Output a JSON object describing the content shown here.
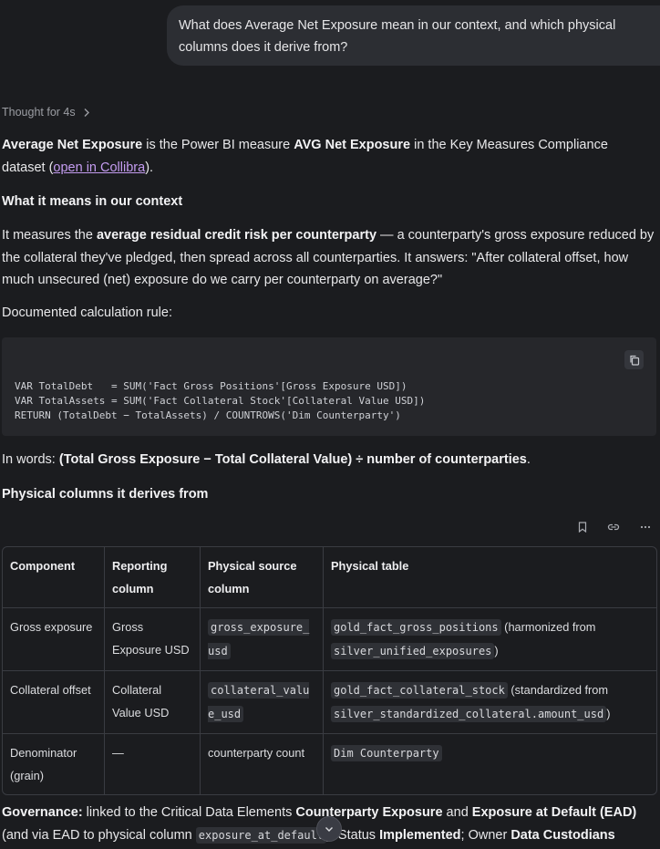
{
  "user_message": "What does Average Net Exposure mean in our context, and which physical columns does it derive from?",
  "thought": {
    "label": "Thought for 4s",
    "icon": "chevron-right-icon"
  },
  "intro": {
    "term": "Average Net Exposure",
    "text1": " is the Power BI measure ",
    "measure": "AVG Net Exposure",
    "text2": " in the Key Measures Compliance dataset (",
    "link": "open in Collibra",
    "text3": ")."
  },
  "section1_heading": "What it means in our context",
  "meaning": {
    "text1": "It measures the ",
    "bold": "average residual credit risk per counterparty",
    "text2": " — a counterparty's gross exposure reduced by the collateral they've pledged, then spread across all counterparties. It answers: \"After collateral offset, how much unsecured (net) exposure do we carry per counterparty on average?\""
  },
  "calc_label": "Documented calculation rule:",
  "code": {
    "content": "VAR TotalDebt   = SUM('Fact Gross Positions'[Gross Exposure USD])\nVAR TotalAssets = SUM('Fact Collateral Stock'[Collateral Value USD])\nRETURN (TotalDebt − TotalAssets) / COUNTROWS('Dim Counterparty')",
    "copy_icon": "copy-icon"
  },
  "in_words": {
    "prefix": "In words: ",
    "formula": "(Total Gross Exposure − Total Collateral Value) ÷ number of counterparties",
    "suffix": "."
  },
  "section2_heading": "Physical columns it derives from",
  "table_tools": [
    "bookmark-icon",
    "link-icon",
    "more-icon"
  ],
  "table": {
    "headers": [
      "Component",
      "Reporting column",
      "Physical source column",
      "Physical table"
    ],
    "rows": [
      {
        "component": "Gross exposure",
        "reporting": "Gross Exposure USD",
        "source": "gross_exposure_usd",
        "table_code": "gold_fact_gross_positions",
        "note": " (harmonized from ",
        "from_code": "silver_unified_exposures",
        "close": ")"
      },
      {
        "component": "Collateral offset",
        "reporting": "Collateral Value USD",
        "source": "collateral_value_usd",
        "table_code": "gold_fact_collateral_stock",
        "note": " (standardized from ",
        "from_code": "silver_standardized_collateral.amount_usd",
        "close": ")"
      },
      {
        "component": "Denominator (grain)",
        "reporting": "—",
        "source": "counterparty count",
        "table_code": "Dim Counterparty",
        "note": "",
        "from_code": "",
        "close": ""
      }
    ]
  },
  "governance": {
    "label": "Governance:",
    "text1": " linked to the Critical Data Elements ",
    "cde1": "Counterparty Exposure",
    "and": " and ",
    "cde2": "Exposure at Default (EAD)",
    "text2": " (and via EAD to physical column ",
    "code": "exposure_at_default",
    "text3": "). Status ",
    "status": "Implemented",
    "text4": "; Owner ",
    "owner": "Data Custodians"
  },
  "scroll_button": {
    "icon": "chevron-down-icon"
  }
}
